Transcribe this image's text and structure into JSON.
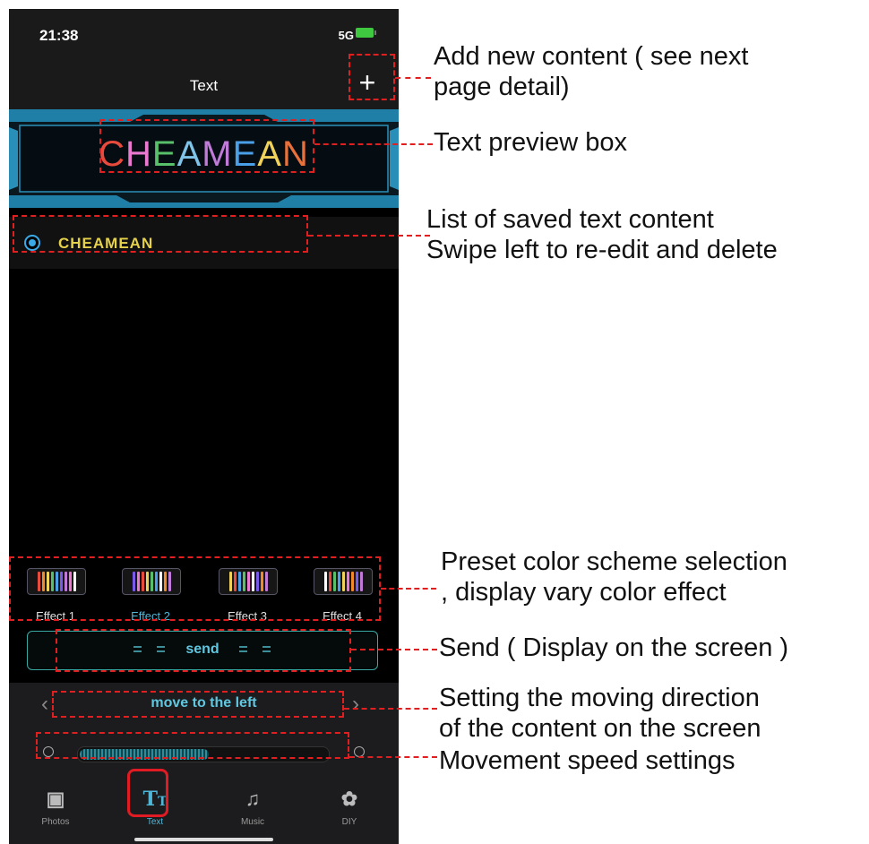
{
  "status_bar": {
    "time": "21:38",
    "network": "5G"
  },
  "nav": {
    "title": "Text",
    "add_icon": "+"
  },
  "preview": {
    "letters": [
      {
        "ch": "C",
        "color": "#e84a3c"
      },
      {
        "ch": "H",
        "color": "#e97ad0"
      },
      {
        "ch": "E",
        "color": "#58c06a"
      },
      {
        "ch": "A",
        "color": "#7fc3e8"
      },
      {
        "ch": "M",
        "color": "#c07ad8"
      },
      {
        "ch": "E",
        "color": "#4aa0e8"
      },
      {
        "ch": "A",
        "color": "#f0d25a"
      },
      {
        "ch": "N",
        "color": "#e8703a"
      }
    ]
  },
  "saved_list": [
    {
      "label": "CHEAMEAN",
      "selected": true
    }
  ],
  "effects": [
    {
      "label": "Effect 1",
      "active": false
    },
    {
      "label": "Effect 2",
      "active": true
    },
    {
      "label": "Effect 3",
      "active": false
    },
    {
      "label": "Effect 4",
      "active": false
    }
  ],
  "send": {
    "label": "send"
  },
  "direction": {
    "label": "move to the left",
    "prev_icon": "‹",
    "next_icon": "›"
  },
  "speed": {
    "level": 0.52
  },
  "tabs": [
    {
      "label": "Photos",
      "icon": "photos-icon",
      "active": false
    },
    {
      "label": "Text",
      "icon": "text-icon",
      "active": true
    },
    {
      "label": "Music",
      "icon": "music-icon",
      "active": false
    },
    {
      "label": "DIY",
      "icon": "palette-icon",
      "active": false
    }
  ],
  "annotations": {
    "add_content": [
      "Add new content ( see next",
      "page detail)"
    ],
    "preview_box": [
      "Text preview box"
    ],
    "saved_list": [
      "List of saved text content",
      "Swipe left to re-edit and delete"
    ],
    "color_scheme": [
      "Preset color scheme selection",
      ", display vary color effect"
    ],
    "send": [
      "Send (  Display on the screen )"
    ],
    "direction": [
      "Setting the moving direction",
      "of the content on the screen"
    ],
    "speed": [
      "Movement speed settings"
    ]
  },
  "colors": {
    "accent": "#4fb6d8",
    "highlight": "#e02020",
    "list_text": "#e6d24a"
  }
}
